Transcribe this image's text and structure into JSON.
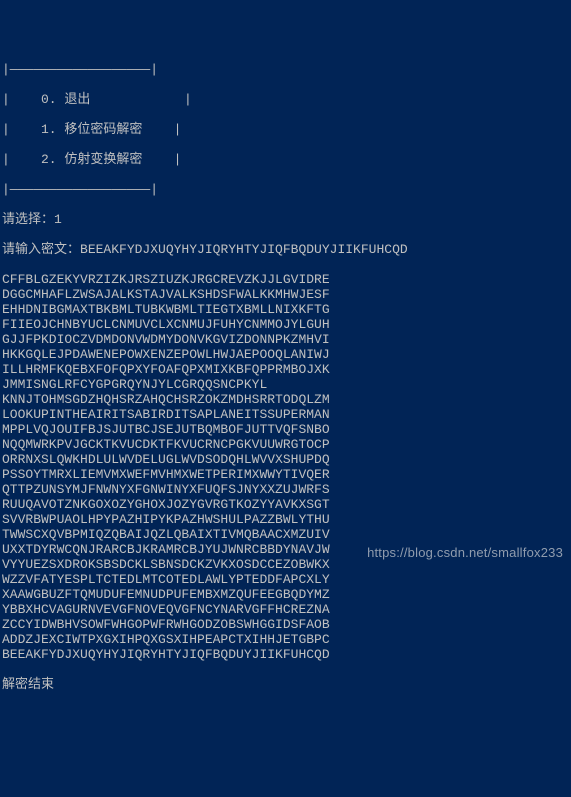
{
  "menu": {
    "border_top": "|——————————————————|",
    "items": [
      "|    0. 退出            |",
      "|    1. 移位密码解密    |",
      "|    2. 仿射变换解密    |"
    ],
    "border_bottom": "|——————————————————|"
  },
  "prompts": {
    "select_label": "请选择：",
    "select_value": "1",
    "input_label": "请输入密文：",
    "input_value": "BEEAKFYDJXUQYHYJIQRYHTYJIQFBQDUYJIIKFUHCQD"
  },
  "output_lines": [
    "CFFBLGZEKYVRZIZKJRSZIUZKJRGCREVZKJJLGVIDRE",
    "DGGCMHAFLZWSAJALKSTAJVALKSHDSFWALKKMHWJESF",
    "EHHDNIBGMAXTBKBMLTUBKWBMLTIEGTXBMLLNIXKFTG",
    "FIIEOJCHNBYUCLCNMUVCLXCNMUJFUHYCNMMOJYLGUH",
    "GJJFPKDIOCZVDMDONVWDMYDONVKGVIZDONNPKZMHVI",
    "HKKGQLEJPDAWENEPOWXENZEPOWLHWJAEPOOQLANIWJ",
    "ILLHRMFKQEBXFOFQPXYFOAFQPXMIXKBFQPPRMBOJXK",
    "JMMISNGLRFCYGPGRQYNJYLCGRQQSNCPKYL",
    "KNNJTOHMSGDZHQHSRZAHQCHSRZOKZMDHSRRTODQLZM",
    "LOOKUPINTHEAIRITSABIRDITSAPLANEITSSUPERMAN",
    "MPPLVQJOUIFBJSJUTBCJSEJUTBQMBOFJUTTVQFSNBO",
    "NQQMWRKPVJGCKTKVUCDKTFKVUCRNCPGKVUUWRGTOCP",
    "ORRNXSLQWKHDLULWVDELUGLWVDSODQHLWVVXSHUPDQ",
    "PSSOYTMRXLIEMVMXWEFMVHMXWETPERIMXWWYTIVQER",
    "QTTPZUNSYMJFNWNYXFGNWINYXFUQFSJNYXXZUJWRFS",
    "RUUQAVOTZNKGOXOZYGHOXJOZYGVRGTKOZYYAVKXSGT",
    "SVVRBWPUAOLHPYPAZHIPYKPAZHWSHULPAZZBWLYTHU",
    "TWWSCXQVBPMIQZQBAIJQZLQBAIXTIVMQBAACXMZUIV",
    "UXXTDYRWCQNJRARCBJKRAMRCBJYUJWNRCBBDYNAVJW",
    "VYYUEZSXDROKSBSDCKLSBNSDCKZVKXOSDCCEZOBWKX",
    "WZZVFATYESPLTCTEDLMTCOTEDLAWLYPTEDDFAPCXLY",
    "XAAWGBUZFTQMUDUFEMNUDPUFEMBXMZQUFEEGBQDYMZ",
    "YBBXHCVAGURNVEVGFNOVEQVGFNCYNARVGFFHCREZNA",
    "ZCCYIDWBHVSOWFWHGOPWFRWHGODZOBSWHGGIDSFAOB",
    "ADDZJEXCIWTPXGXIHPQXGSXIHPEAPCTXIHHJETGBPC",
    "BEEAKFYDJXUQYHYJIQRYHTYJIQFBQDUYJIIKFUHCQD"
  ],
  "end_label": "解密结束",
  "watermark": "https://blog.csdn.net/smallfox233"
}
